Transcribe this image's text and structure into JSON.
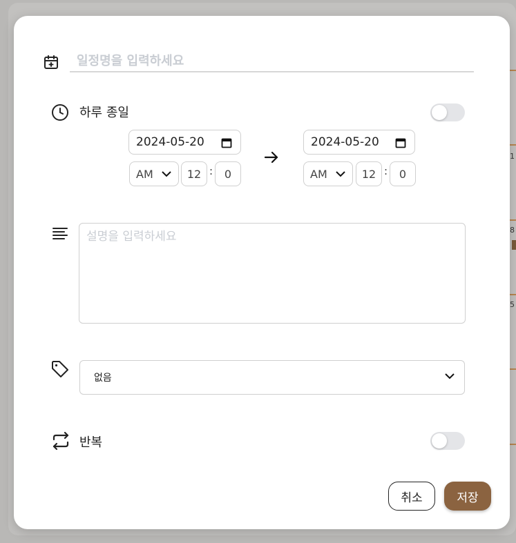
{
  "modal": {
    "title_placeholder": "일정명을 입력하세요",
    "all_day": {
      "label": "하루 종일",
      "on": false
    },
    "start": {
      "date": "2024-05-20",
      "ampm": "AM",
      "hour": "12",
      "minute": "0"
    },
    "end": {
      "date": "2024-05-20",
      "ampm": "AM",
      "hour": "12",
      "minute": "0"
    },
    "time_separator": ":",
    "description_placeholder": "설명을 입력하세요",
    "tag": {
      "selected": "없음"
    },
    "repeat": {
      "label": "반복",
      "on": false
    },
    "buttons": {
      "cancel": "취소",
      "save": "저장"
    }
  },
  "background": {
    "fragments": [
      "1",
      "8",
      "5"
    ]
  },
  "colors": {
    "accent": "#8b6340",
    "toggle_off": "#e4e5e8",
    "border": "#cfcfcf",
    "placeholder": "#c9cdd3"
  }
}
